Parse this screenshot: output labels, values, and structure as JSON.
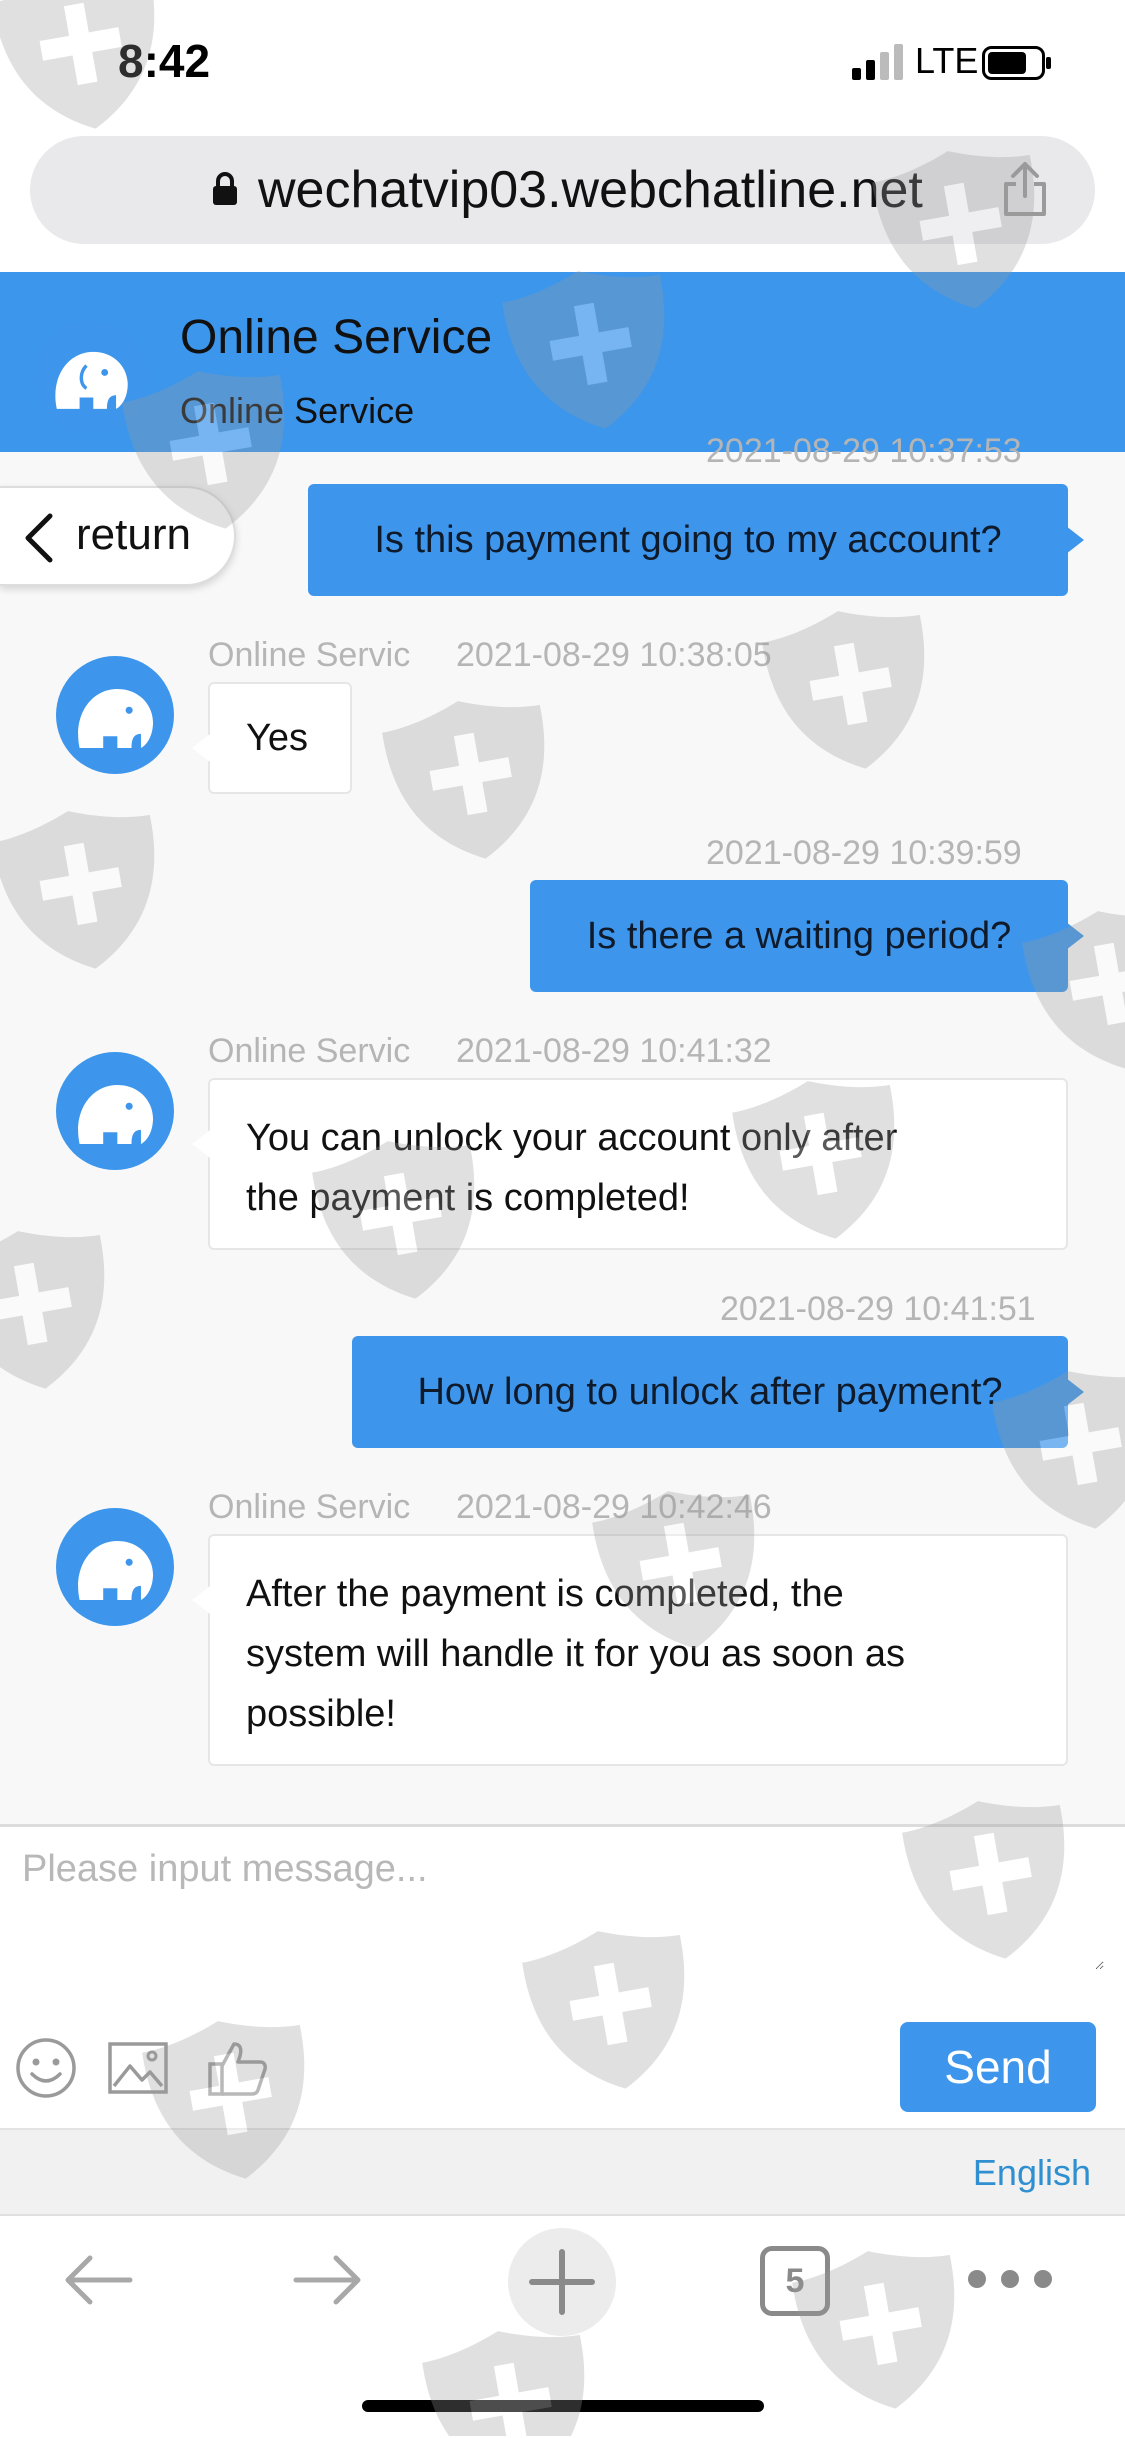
{
  "status_bar": {
    "time": "8:42",
    "network": "LTE"
  },
  "browser": {
    "url": "wechatvip03.webchatline.net",
    "tab_count": "5"
  },
  "header": {
    "title": "Online Service",
    "subtitle": "Online Service"
  },
  "return_label": "return",
  "messages": [
    {
      "direction": "out",
      "timestamp": "2021-08-29 10:37:53",
      "text": "Is this payment going to my account?"
    },
    {
      "direction": "in",
      "sender": "Online Servic",
      "timestamp": "2021-08-29 10:38:05",
      "lines": [
        "Yes"
      ]
    },
    {
      "direction": "out",
      "timestamp": "2021-08-29 10:39:59",
      "text": "Is there a waiting period?"
    },
    {
      "direction": "in",
      "sender": "Online Servic",
      "timestamp": "2021-08-29 10:41:32",
      "lines": [
        "You can unlock your account only after",
        "the payment is completed!"
      ]
    },
    {
      "direction": "out",
      "timestamp": "2021-08-29 10:41:51",
      "text": "How long to unlock after payment?"
    },
    {
      "direction": "in",
      "sender": "Online Servic",
      "timestamp": "2021-08-29 10:42:46",
      "lines": [
        "After the payment is completed, the",
        "system will handle it for you as soon as",
        "possible!"
      ]
    }
  ],
  "composer": {
    "placeholder": "Please input message...",
    "send_label": "Send",
    "tools": [
      "emoji-icon",
      "image-icon",
      "thumbs-up-icon"
    ]
  },
  "language": "English",
  "colors": {
    "accent": "#3d96ec",
    "link": "#2f8fd0"
  }
}
